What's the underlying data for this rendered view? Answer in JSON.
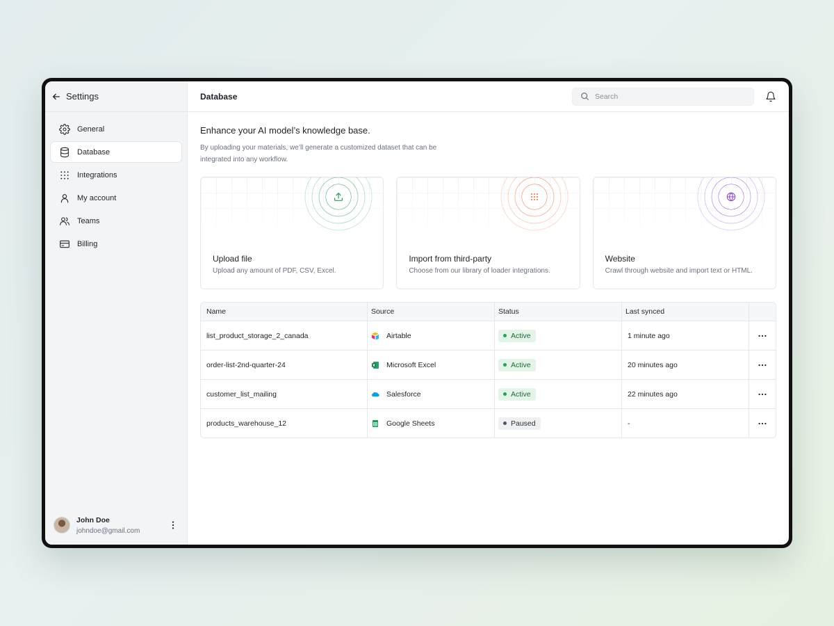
{
  "sidebar": {
    "title": "Settings",
    "items": [
      {
        "label": "General",
        "icon": "gear-icon"
      },
      {
        "label": "Database",
        "icon": "database-icon",
        "active": true
      },
      {
        "label": "Integrations",
        "icon": "grid-dots-icon"
      },
      {
        "label": "My account",
        "icon": "user-icon"
      },
      {
        "label": "Teams",
        "icon": "users-icon"
      },
      {
        "label": "Billing",
        "icon": "credit-card-icon"
      }
    ],
    "user": {
      "name": "John Doe",
      "email": "johndoe@gmail.com"
    }
  },
  "topbar": {
    "title": "Database",
    "search_placeholder": "Search"
  },
  "main": {
    "headline": "Enhance your AI model’s knowledge base.",
    "description": "By uploading your materials, we’ll generate a customized dataset that can be integrated into any workflow.",
    "cards": [
      {
        "title": "Upload file",
        "subtitle": "Upload any amount of PDF, CSV, Excel.",
        "accent": "#22a05a",
        "icon": "upload-icon"
      },
      {
        "title": "Import from third-party",
        "subtitle": "Choose from our library of loader integrations.",
        "accent": "#f06a2b",
        "icon": "grid-dots-icon"
      },
      {
        "title": "Website",
        "subtitle": "Crawl through website and import text or HTML.",
        "accent": "#8b46d6",
        "icon": "globe-icon"
      }
    ]
  },
  "table": {
    "columns": [
      "Name",
      "Source",
      "Status",
      "Last synced"
    ],
    "rows": [
      {
        "name": "list_product_storage_2_canada",
        "source": "Airtable",
        "source_icon": "airtable-icon",
        "status": "Active",
        "synced": "1 minute ago"
      },
      {
        "name": "order-list-2nd-quarter-24",
        "source": "Microsoft Excel",
        "source_icon": "excel-icon",
        "status": "Active",
        "synced": "20 minutes ago"
      },
      {
        "name": "customer_list_mailing",
        "source": "Salesforce",
        "source_icon": "salesforce-icon",
        "status": "Active",
        "synced": "22 minutes ago"
      },
      {
        "name": "products_warehouse_12",
        "source": "Google Sheets",
        "source_icon": "google-sheets-icon",
        "status": "Paused",
        "synced": "-"
      }
    ]
  }
}
